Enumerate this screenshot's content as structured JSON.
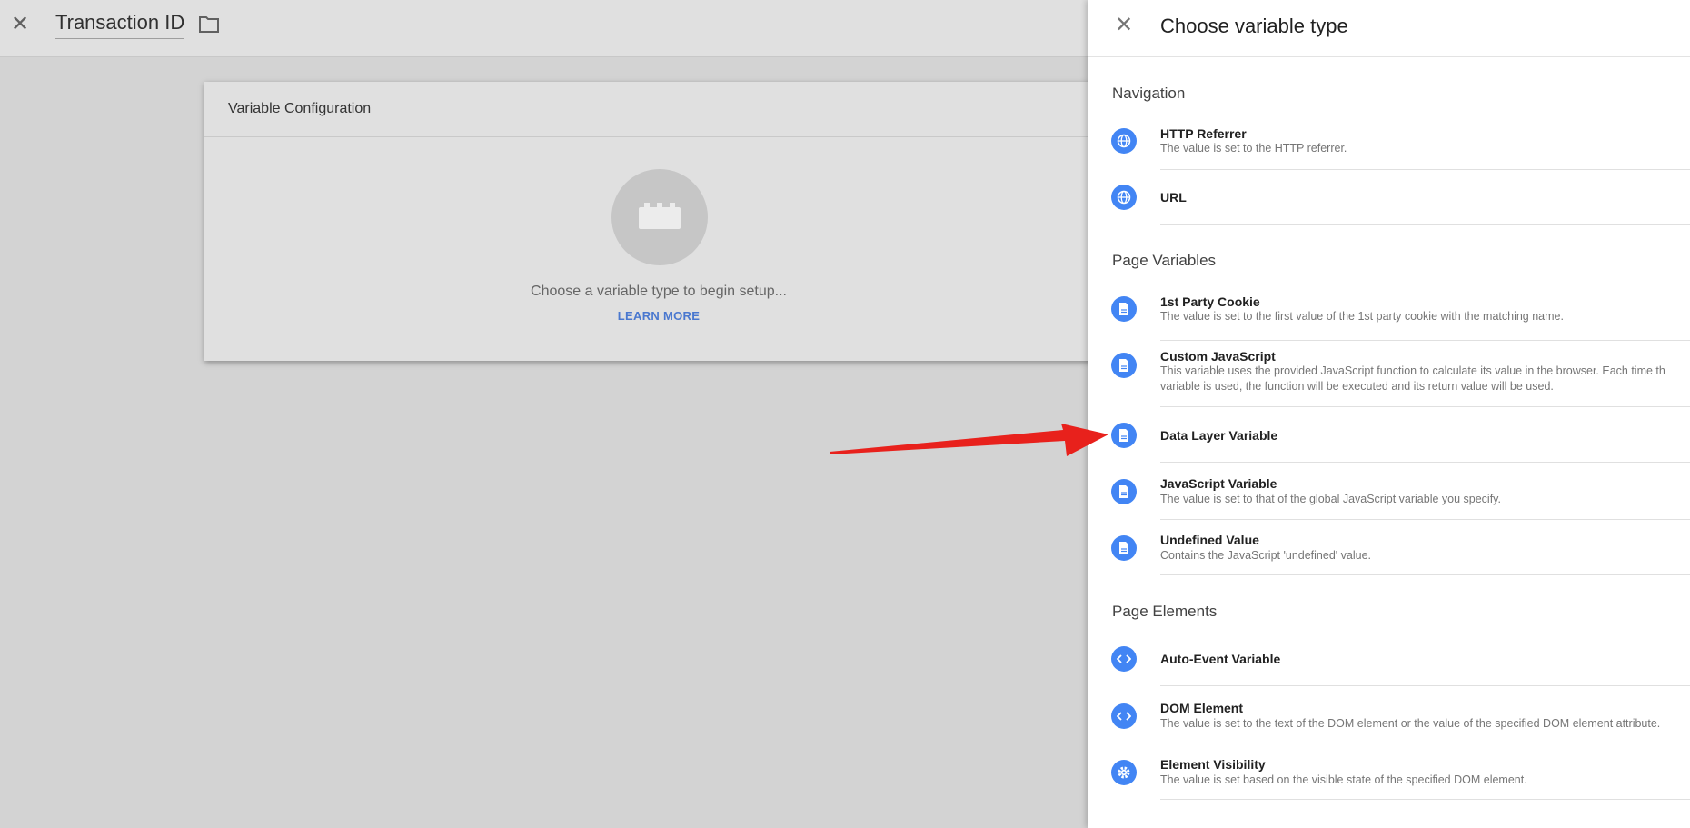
{
  "editor": {
    "title": "Transaction ID",
    "card_title": "Variable Configuration",
    "hint": "Choose a variable type to begin setup...",
    "learn_more": "LEARN MORE"
  },
  "panel": {
    "title": "Choose variable type",
    "sections": {
      "navigation": "Navigation",
      "page_variables": "Page Variables",
      "page_elements": "Page Elements"
    },
    "items": {
      "http_referrer": {
        "name": "HTTP Referrer",
        "desc": "The value is set to the HTTP referrer."
      },
      "url": {
        "name": "URL"
      },
      "first_party_cookie": {
        "name": "1st Party Cookie",
        "desc": "The value is set to the first value of the 1st party cookie with the matching name."
      },
      "custom_javascript": {
        "name": "Custom JavaScript",
        "desc1": "This variable uses the provided JavaScript function to calculate its value in the browser. Each time th",
        "desc2": "variable is used, the function will be executed and its return value will be used."
      },
      "data_layer_variable": {
        "name": "Data Layer Variable"
      },
      "javascript_variable": {
        "name": "JavaScript Variable",
        "desc": "The value is set to that of the global JavaScript variable you specify."
      },
      "undefined_value": {
        "name": "Undefined Value",
        "desc": "Contains the JavaScript 'undefined' value."
      },
      "auto_event_variable": {
        "name": "Auto-Event Variable"
      },
      "dom_element": {
        "name": "DOM Element",
        "desc": "The value is set to the text of the DOM element or the value of the specified DOM element attribute."
      },
      "element_visibility": {
        "name": "Element Visibility",
        "desc": "The value is set based on the visible state of the specified DOM element."
      }
    }
  },
  "colors": {
    "accent": "#4285f4",
    "arrow": "#e8211c",
    "link": "#4a78cf"
  },
  "icons": [
    "close-icon",
    "folder-icon",
    "lego-brick-icon",
    "globe-icon",
    "document-icon",
    "code-icon",
    "gear-icon",
    "red-arrow"
  ]
}
